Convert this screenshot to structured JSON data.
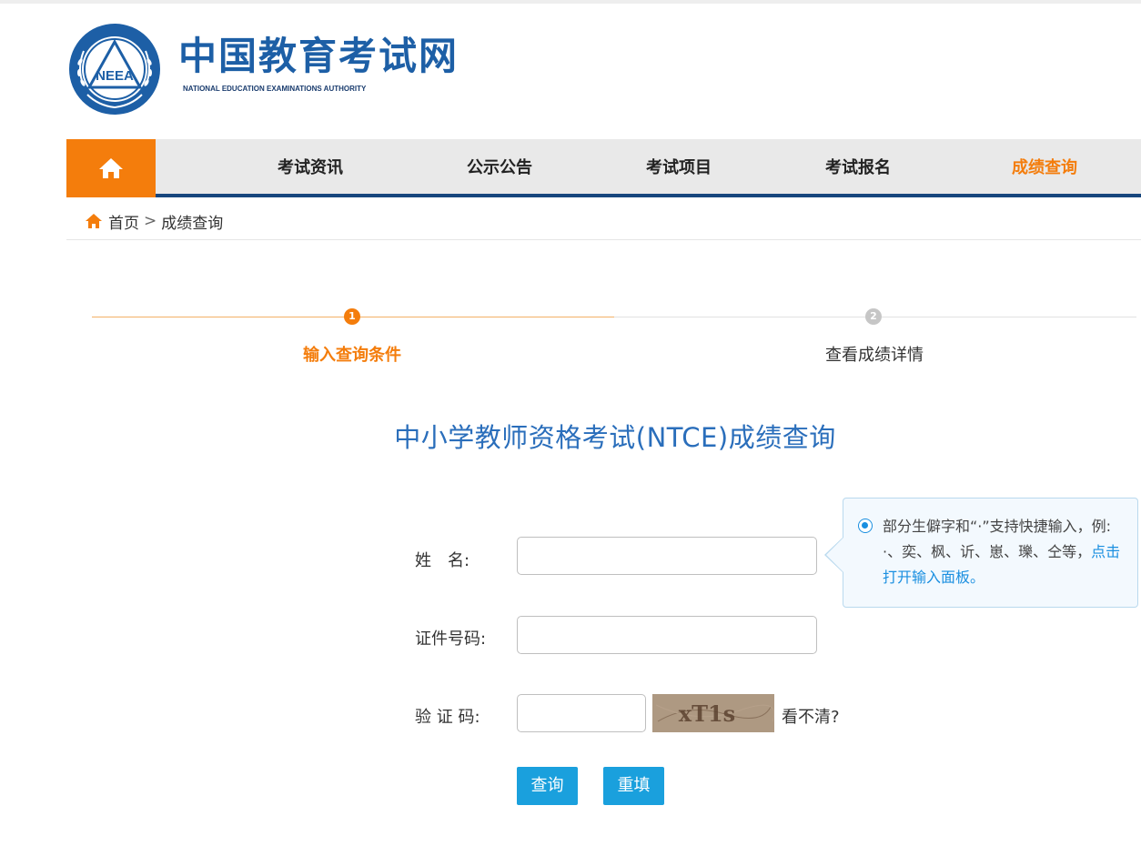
{
  "header": {
    "logo_text": "NEEA",
    "site_name_cn": "中国教育考试网",
    "site_name_en": "NATIONAL EDUCATION EXAMINATIONS AUTHORITY"
  },
  "nav": {
    "home_icon": "home-icon",
    "items": [
      {
        "label": "考试资讯",
        "active": false
      },
      {
        "label": "公示公告",
        "active": false
      },
      {
        "label": "考试项目",
        "active": false
      },
      {
        "label": "考试报名",
        "active": false
      },
      {
        "label": "成绩查询",
        "active": true
      }
    ],
    "active_color": "#f47d0c",
    "bar_color": "#17467d"
  },
  "breadcrumb": {
    "home": "首页",
    "separator": ">",
    "current": "成绩查询"
  },
  "steps": [
    {
      "number": "1",
      "label": "输入查询条件",
      "active": true
    },
    {
      "number": "2",
      "label": "查看成绩详情",
      "active": false
    }
  ],
  "page_title": "中小学教师资格考试(NTCE)成绩查询",
  "form": {
    "name_label": "姓　名:",
    "name_value": "",
    "id_label": "证件号码:",
    "id_value": "",
    "captcha_label": "验 证 码:",
    "captcha_value": "",
    "captcha_text": "xT1s",
    "captcha_refresh": "看不清?",
    "submit_label": "查询",
    "reset_label": "重填"
  },
  "tooltip": {
    "text": "部分生僻字和“·”支持快捷输入，例: ·、奕、枫、䜣、崽、瓅、仝等，",
    "link": "点击打开输入面板。"
  },
  "colors": {
    "brand_blue": "#1d5fa6",
    "orange": "#f47d0c",
    "button_blue": "#1aa0dd",
    "title_blue": "#2a6ebb"
  }
}
